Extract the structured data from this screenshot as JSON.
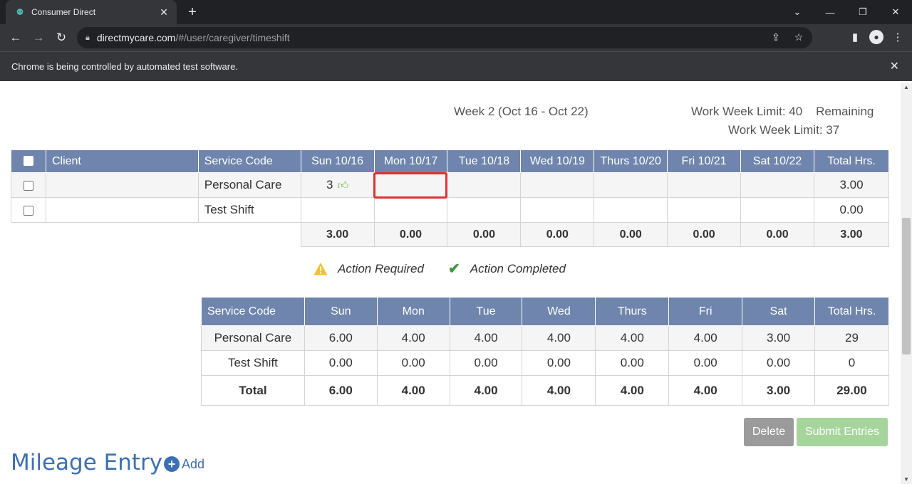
{
  "browser": {
    "tab_title": "Consumer Direct",
    "url_host": "directmycare.com",
    "url_path": "/#/user/caregiver/timeshift",
    "infobar_text": "Chrome is being controlled by automated test software."
  },
  "week": {
    "label": "Week 2 (Oct 16 - Oct 22)",
    "limit_text": "Work Week Limit: 40    Remaining",
    "remaining_text": "Work Week Limit: 37"
  },
  "entries_table": {
    "headers": [
      "Client",
      "Service Code",
      "Sun 10/16",
      "Mon 10/17",
      "Tue 10/18",
      "Wed 10/19",
      "Thurs 10/20",
      "Fri 10/21",
      "Sat 10/22",
      "Total Hrs."
    ],
    "rows": [
      {
        "client": "",
        "service": "Personal Care",
        "days": [
          "3",
          "",
          "",
          "",
          "",
          "",
          ""
        ],
        "total": "3.00"
      },
      {
        "client": "",
        "service": "Test Shift",
        "days": [
          "",
          "",
          "",
          "",
          "",
          "",
          ""
        ],
        "total": "0.00"
      }
    ],
    "totals": [
      "3.00",
      "0.00",
      "0.00",
      "0.00",
      "0.00",
      "0.00",
      "0.00",
      "3.00"
    ]
  },
  "legend": {
    "action_required": "Action Required",
    "action_completed": "Action Completed"
  },
  "summary_table": {
    "headers": [
      "Service Code",
      "Sun",
      "Mon",
      "Tue",
      "Wed",
      "Thurs",
      "Fri",
      "Sat",
      "Total Hrs."
    ],
    "rows": [
      [
        "Personal Care",
        "6.00",
        "4.00",
        "4.00",
        "4.00",
        "4.00",
        "4.00",
        "3.00",
        "29"
      ],
      [
        "Test Shift",
        "0.00",
        "0.00",
        "0.00",
        "0.00",
        "0.00",
        "0.00",
        "0.00",
        "0"
      ]
    ],
    "totals": [
      "Total",
      "6.00",
      "4.00",
      "4.00",
      "4.00",
      "4.00",
      "4.00",
      "3.00",
      "29.00"
    ]
  },
  "buttons": {
    "delete": "Delete",
    "submit": "Submit Entries"
  },
  "mileage": {
    "title": "Mileage Entry",
    "add": "Add"
  },
  "colors": {
    "header_bg": "#6f85ad",
    "selected_outline": "#e03030",
    "link_blue": "#3b6fb6"
  }
}
